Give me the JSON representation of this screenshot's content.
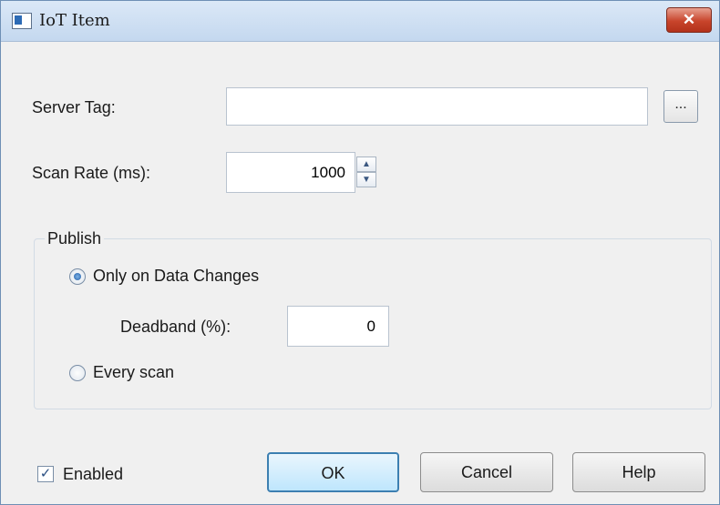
{
  "window": {
    "title": "IoT Item",
    "close_label": "✕"
  },
  "form": {
    "server_tag": {
      "label": "Server Tag:",
      "value": "",
      "browse_label": "..."
    },
    "scan_rate": {
      "label": "Scan Rate (ms):",
      "value": "1000",
      "up": "▲",
      "down": "▼"
    }
  },
  "publish": {
    "title": "Publish",
    "only_on_changes": {
      "label": "Only on Data Changes",
      "checked": true
    },
    "deadband": {
      "label": "Deadband (%):",
      "value": "0"
    },
    "every_scan": {
      "label": "Every scan",
      "checked": false
    }
  },
  "enabled": {
    "label": "Enabled",
    "checked": true,
    "mark": "✓"
  },
  "buttons": {
    "ok": "OK",
    "cancel": "Cancel",
    "help": "Help"
  },
  "colors": {
    "close_button": "#c8442b",
    "default_button_border": "#3c7fb1",
    "titlebar": "#c4d8ef"
  }
}
